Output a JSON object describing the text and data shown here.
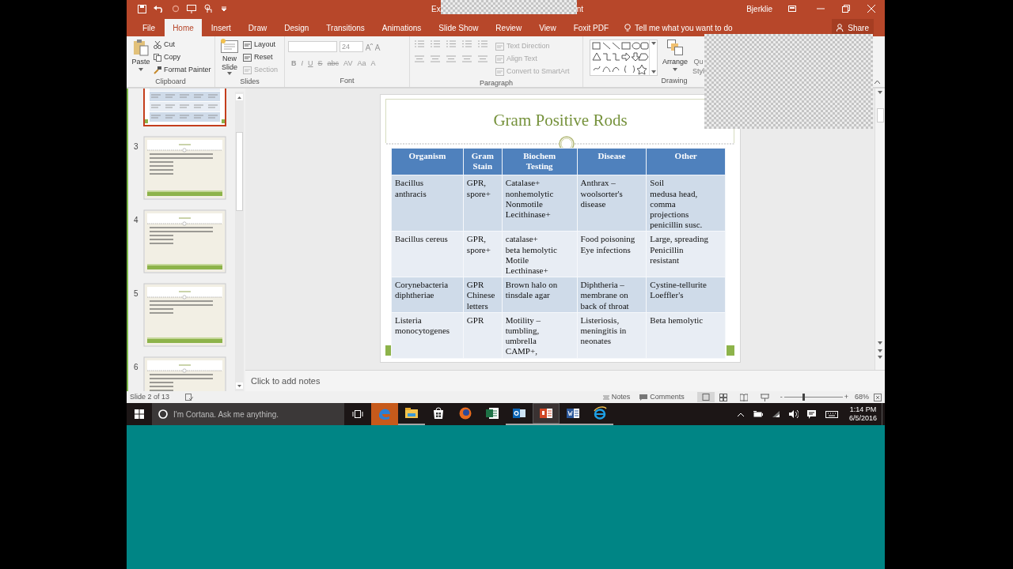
{
  "window": {
    "title_start": "Ex",
    "title_end": "nt",
    "user": "Bjerklie"
  },
  "tabs": [
    {
      "label": "File",
      "selected": false
    },
    {
      "label": "Home",
      "selected": true
    },
    {
      "label": "Insert",
      "selected": false
    },
    {
      "label": "Draw",
      "selected": false
    },
    {
      "label": "Design",
      "selected": false
    },
    {
      "label": "Transitions",
      "selected": false
    },
    {
      "label": "Animations",
      "selected": false
    },
    {
      "label": "Slide Show",
      "selected": false
    },
    {
      "label": "Review",
      "selected": false
    },
    {
      "label": "View",
      "selected": false
    },
    {
      "label": "Foxit PDF",
      "selected": false
    }
  ],
  "tell_me": "Tell me what you want to do",
  "share": "Share",
  "ribbon": {
    "clipboard": {
      "paste": "Paste",
      "items": [
        {
          "label": "Cut",
          "disabled": false
        },
        {
          "label": "Copy",
          "disabled": false
        },
        {
          "label": "Format Painter",
          "disabled": false
        }
      ],
      "label": "Clipboard"
    },
    "slides": {
      "new_slide": "New Slide",
      "items": [
        {
          "label": "Layout",
          "disabled": false
        },
        {
          "label": "Reset",
          "disabled": false
        },
        {
          "label": "Section",
          "disabled": true
        }
      ],
      "label": "Slides"
    },
    "font": {
      "size": "24",
      "buttons": [
        "B",
        "I",
        "U",
        "S",
        "abc",
        "AV",
        "Aa",
        "A"
      ],
      "label": "Font"
    },
    "paragraph": {
      "items": [
        {
          "label": "Text Direction",
          "disabled": true
        },
        {
          "label": "Align Text",
          "disabled": true
        },
        {
          "label": "Convert to SmartArt",
          "disabled": true
        }
      ],
      "label": "Paragraph"
    },
    "drawing": {
      "arrange": "Arrange",
      "quick_styles_top": "Qu",
      "quick_styles_bottom": "Styl",
      "label": "Drawing"
    }
  },
  "thumbnails": [
    {
      "kind": "table",
      "selected": true
    },
    {
      "number": "3",
      "kind": "question",
      "selected": false
    },
    {
      "number": "4",
      "kind": "question",
      "selected": false
    },
    {
      "number": "5",
      "kind": "question",
      "selected": false
    },
    {
      "number": "6",
      "kind": "question",
      "selected": false
    }
  ],
  "slide": {
    "title": "Gram Positive Rods",
    "table": {
      "columns": [
        "Organism",
        "Gram\nStain",
        "Biochem\nTesting",
        "Disease",
        "Other"
      ],
      "rows": [
        [
          "Bacillus\nanthracis",
          "GPR,\nspore+",
          "Catalase+\nnonhemolytic\nNonmotile\nLecithinase+",
          "Anthrax –\nwoolsorter's\ndisease",
          "Soil\nmedusa head,\ncomma\nprojections\npenicillin susc."
        ],
        [
          "Bacillus cereus",
          "GPR,\nspore+",
          "catalase+\nbeta hemolytic\nMotile\nLecthinase+",
          "Food poisoning\nEye infections",
          "Large, spreading\nPenicillin\nresistant"
        ],
        [
          "Corynebacteria\ndiphtheriae",
          "GPR\nChinese\nletters",
          "Brown halo on\ntinsdale agar",
          "Diphtheria –\nmembrane on\nback of throat",
          "Cystine-tellurite\nLoeffler's"
        ],
        [
          "Listeria\nmonocytogenes",
          "GPR",
          "Motility –\ntumbling,\numbrella\nCAMP+,",
          "Listeriosis,\nmeningitis in\nneonates",
          "Beta hemolytic"
        ]
      ]
    }
  },
  "notes_placeholder": "Click to add notes",
  "status_bar": {
    "slide_indicator": "Slide 2 of 13",
    "notes": "Notes",
    "comments": "Comments",
    "zoom_out": "-",
    "zoom_in": "+",
    "zoom": "68%",
    "level": 0.33
  },
  "taskbar": {
    "search_placeholder": "I'm Cortana. Ask me anything.",
    "apps": [
      {
        "kind": "edge",
        "hovered": true,
        "selected": false,
        "running": false
      },
      {
        "kind": "explorer",
        "hovered": false,
        "selected": false,
        "running": true
      },
      {
        "kind": "store",
        "hovered": false,
        "selected": false,
        "running": false
      },
      {
        "kind": "firefox",
        "hovered": false,
        "selected": false,
        "running": false
      },
      {
        "kind": "excel",
        "hovered": false,
        "selected": false,
        "running": false
      },
      {
        "kind": "outlook",
        "hovered": false,
        "selected": false,
        "running": true
      },
      {
        "kind": "powerpoint",
        "hovered": false,
        "selected": true,
        "running": true
      },
      {
        "kind": "word",
        "hovered": false,
        "selected": false,
        "running": true
      },
      {
        "kind": "ie",
        "hovered": false,
        "selected": false,
        "running": true
      }
    ],
    "time": "1:14 PM",
    "date": "6/5/2016"
  }
}
